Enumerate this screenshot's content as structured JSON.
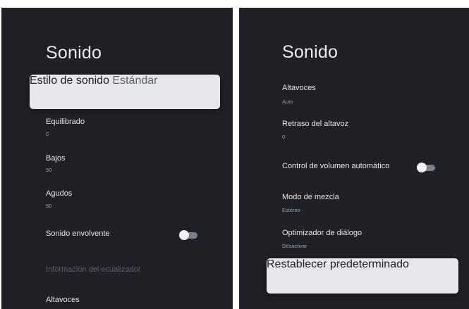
{
  "left": {
    "title": "Sonido",
    "items": [
      {
        "label": "Estilo de sonido",
        "value": "Estándar"
      },
      {
        "label": "Equilibrado",
        "value": "0"
      },
      {
        "label": "Bajos",
        "value": "50"
      },
      {
        "label": "Agudos",
        "value": "50"
      },
      {
        "label": "Sonido envolvente",
        "toggle": "off"
      },
      {
        "label": "Información del ecualizador",
        "state": "disabled"
      },
      {
        "label": "Altavoces"
      }
    ]
  },
  "right": {
    "title": "Sonido",
    "items": [
      {
        "label": "Altavoces",
        "value": "Auto"
      },
      {
        "label": "Retraso del altavoz",
        "value": "0"
      },
      {
        "label": "Control de volumen automático",
        "toggle": "off"
      },
      {
        "label": "Modo de mezcla",
        "value": "Estéreo"
      },
      {
        "label": "Optimizador de diálogo",
        "value": "Desactivar"
      },
      {
        "label": "Restablecer predeterminado"
      }
    ]
  },
  "colors": {
    "panel_bg": "#202126",
    "focused_bg": "#e6e7eb",
    "text_primary": "#e3e5e8",
    "text_secondary": "#9aa0a6"
  }
}
